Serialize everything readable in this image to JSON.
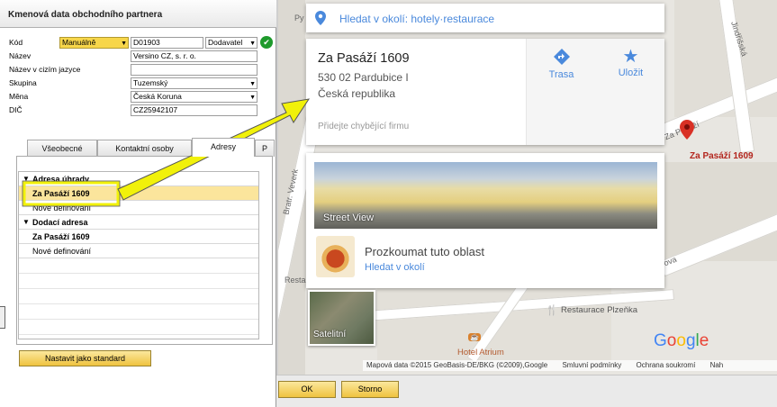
{
  "sap": {
    "title": "Kmenová data obchodního partnera",
    "fields": {
      "kod_label": "Kód",
      "kod_series": "Manuálně",
      "kod_value": "D01903",
      "kod_type": "Dodavatel",
      "nazev_label": "Název",
      "nazev_value": "Versino CZ, s. r. o.",
      "nazev_cizi_label": "Název v cizím jazyce",
      "nazev_cizi_value": "",
      "skupina_label": "Skupina",
      "skupina_value": "Tuzemský",
      "mena_label": "Měna",
      "mena_value": "Česká Koruna",
      "dic_label": "DIČ",
      "dic_value": "CZ25942107"
    },
    "tabs": [
      "Všeobecné",
      "Kontaktní osoby",
      "Adresy",
      "P"
    ],
    "grid": {
      "group1": "Adresa úhrady",
      "group1_item": "Za Pasáží 1609",
      "group1_new": "Nové definování",
      "group2": "Dodací adresa",
      "group2_item": "Za Pasáží 1609",
      "group2_new": "Nové definování"
    },
    "set_default_button": "Nastavit jako standard",
    "ok_button": "OK",
    "cancel_button": "Storno"
  },
  "map": {
    "search_text": "Hledat v okolí: hotely·restaurace",
    "place_name": "Za Pasáží 1609",
    "address_line1": "530 02 Pardubice I",
    "address_line2": "Česká republika",
    "add_business": "Přidejte chybějící firmu",
    "route_label": "Trasa",
    "save_label": "Uložit",
    "street_view_label": "Street View",
    "explore_title": "Prozkoumat tuto oblast",
    "explore_link": "Hledat v okolí",
    "satellite_label": "Satelitní",
    "marker_label": "Za Pasáží 1609",
    "restaurant_label": "Restaurace Plzeňka",
    "hotel_label": "Hotel Atrium",
    "street_labels": [
      "Jindřišská",
      "Za Pasáží",
      "Bratr. Veverk",
      "Resta",
      "ova",
      "Py"
    ],
    "copyright": "Mapová data ©2015 GeoBasis-DE/BKG (©2009),Google",
    "terms": "Smluvní podmínky",
    "privacy": "Ochrana soukromí",
    "report": "Nah",
    "google_logo": "Google"
  },
  "colors": {
    "sap_yellow": "#f7d64a",
    "selection": "#fbe59c",
    "link_blue": "#4a89dc",
    "marker_red": "#d93025",
    "arrow_yellow": "#f1f10a"
  }
}
